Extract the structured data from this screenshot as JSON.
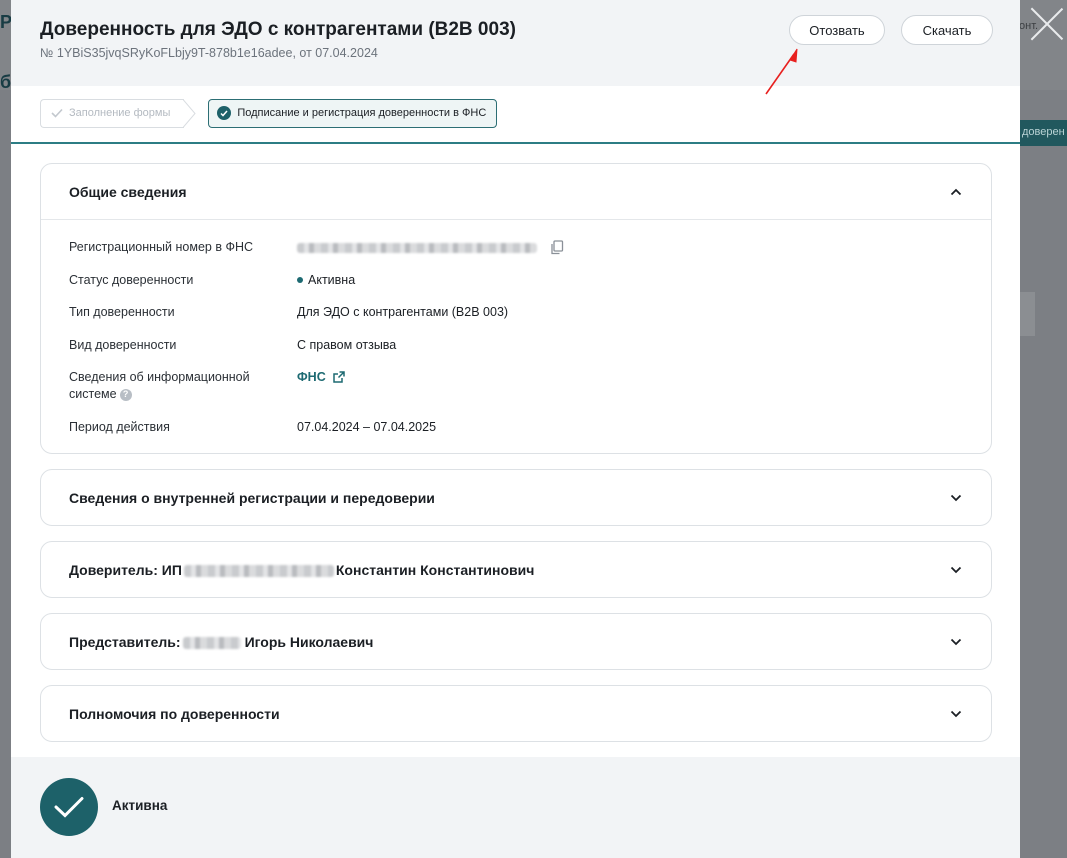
{
  "background": {
    "left_letter": "Р",
    "left_letter2": "б",
    "right_text": "онт.",
    "strip_text": "доверен"
  },
  "header": {
    "title": "Доверенность для ЭДО с контрагентами (B2B 003)",
    "subtitle": "№ 1YBiS35jvqSRyKoFLbjy9T-878b1e16adee, от 07.04.2024",
    "revoke_label": "Отозвать",
    "download_label": "Скачать"
  },
  "stepper": {
    "step1_label": "Заполнение формы",
    "step2_label": "Подписание и регистрация доверенности в ФНС"
  },
  "general": {
    "title": "Общие сведения",
    "rows": [
      {
        "label": "Регистрационный номер в ФНС",
        "value": ""
      },
      {
        "label": "Статус доверенности",
        "value": "Активна"
      },
      {
        "label": "Тип доверенности",
        "value": "Для ЭДО с контрагентами (B2B 003)"
      },
      {
        "label": "Вид доверенности",
        "value": "С правом отзыва"
      },
      {
        "label": "Сведения об информационной системе",
        "value": "ФНС"
      },
      {
        "label": "Период действия",
        "value": "07.04.2024 – 07.04.2025"
      }
    ]
  },
  "sections": {
    "internal": "Сведения о внутренней регистрации и передоверии",
    "principal_prefix": "Доверитель: ИП",
    "principal_suffix": "Константин Константинович",
    "representative_prefix": "Представитель:",
    "representative_suffix": "Игорь Николаевич",
    "powers": "Полномочия по доверенности"
  },
  "footer": {
    "status": "Активна"
  },
  "colors": {
    "accent": "#1d6169",
    "annotation": "#e8201f"
  }
}
